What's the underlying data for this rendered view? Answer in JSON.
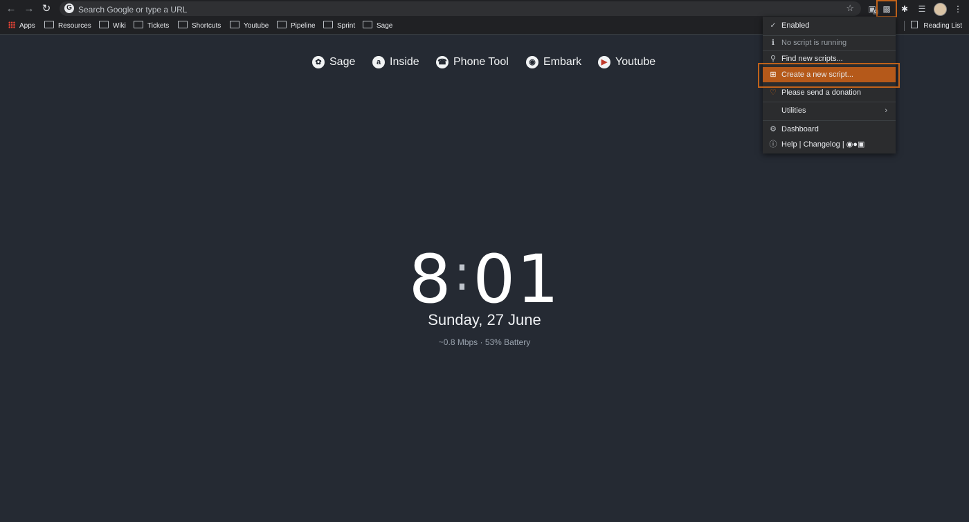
{
  "toolbar": {
    "back_icon": "arrow-left-icon",
    "forward_icon": "arrow-right-icon",
    "reload_icon": "reload-icon",
    "omnibox_placeholder": "Search Google or type a URL",
    "extension_badge": "0"
  },
  "bookmarks": {
    "items": [
      "Apps",
      "Resources",
      "Wiki",
      "Tickets",
      "Shortcuts",
      "Youtube",
      "Pipeline",
      "Sprint",
      "Sage"
    ],
    "reading_list": "Reading List"
  },
  "shortcuts": [
    "Sage",
    "Inside",
    "Phone Tool",
    "Embark",
    "Youtube"
  ],
  "clock": {
    "hours": "8",
    "colon": ":",
    "minutes": "01",
    "date": "Sunday, 27 June",
    "status": "~0.8 Mbps · 53% Battery"
  },
  "menu": {
    "enabled": "Enabled",
    "no_script": "No script is running",
    "find_scripts": "Find new scripts...",
    "create_script": "Create a new script...",
    "donate": "Please send a donation",
    "utilities": "Utilities",
    "dashboard": "Dashboard",
    "help": "Help | Changelog |"
  },
  "colors": {
    "accent": "#b5591a",
    "highlight_outline": "#c0621a",
    "background": "#252a33"
  }
}
